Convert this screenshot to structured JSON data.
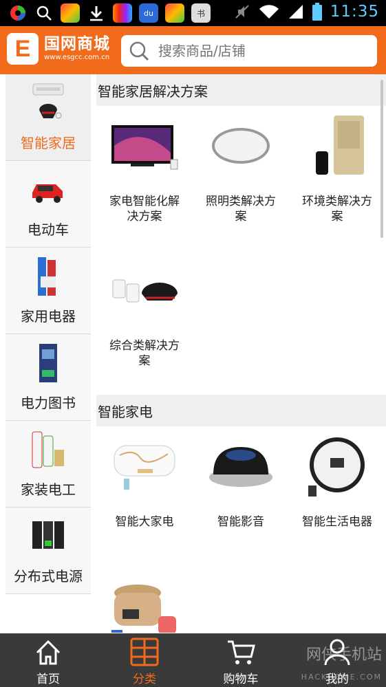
{
  "status_bar": {
    "time": "11:35",
    "left_icons": [
      "app-icon",
      "search-icon",
      "app-icon",
      "download-icon",
      "app-icon",
      "baidu-icon",
      "app-icon",
      "app-icon"
    ],
    "right_icons": [
      "mute-icon",
      "wifi-icon",
      "signal-icon",
      "battery-icon"
    ]
  },
  "header": {
    "logo_letter": "E",
    "logo_title": "国网商城",
    "logo_sub": "www.esgcc.com.cn",
    "search_placeholder": "搜索商品/店铺",
    "bg_color": "#f26b1d"
  },
  "sidebar": {
    "items": [
      {
        "label": "智能家居",
        "active": true
      },
      {
        "label": "电动车",
        "active": false
      },
      {
        "label": "家用电器",
        "active": false
      },
      {
        "label": "电力图书",
        "active": false
      },
      {
        "label": "家装电工",
        "active": false
      },
      {
        "label": "分布式电源",
        "active": false
      }
    ]
  },
  "sections": [
    {
      "title": "智能家居解决方案",
      "items": [
        {
          "label": "家电智能化解决方案"
        },
        {
          "label": "照明类解决方案"
        },
        {
          "label": "环境类解决方案"
        },
        {
          "label": "综合类解决方案"
        }
      ]
    },
    {
      "title": "智能家电",
      "items": [
        {
          "label": "智能大家电"
        },
        {
          "label": "智能影音"
        },
        {
          "label": "智能生活电器"
        },
        {
          "label": ""
        }
      ]
    }
  ],
  "bottom_nav": {
    "items": [
      {
        "label": "首页",
        "active": false
      },
      {
        "label": "分类",
        "active": true
      },
      {
        "label": "购物车",
        "active": false
      },
      {
        "label": "我的",
        "active": false
      }
    ]
  },
  "watermark": {
    "text": "网侠手机站",
    "sub": "HACKHOME.COM"
  },
  "colors": {
    "accent": "#f26b1d",
    "nav_bg": "#3a3a3a",
    "time": "#5ecbff"
  }
}
